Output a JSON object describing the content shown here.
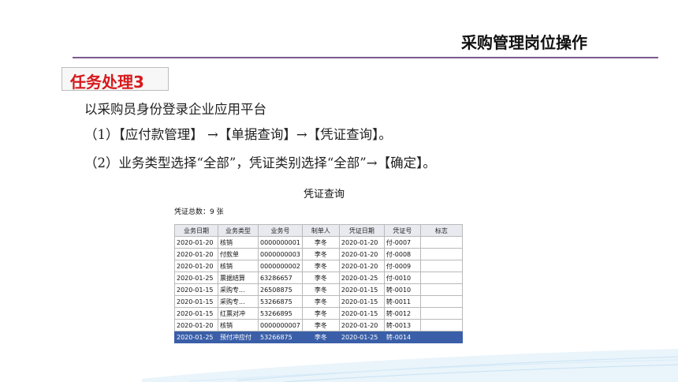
{
  "header": {
    "title": "采购管理岗位操作"
  },
  "task": {
    "label": "任务处理3"
  },
  "instructions": [
    "以采购员身份登录企业应用平台",
    "（1）【应付款管理】 →【单据查询】→【凭证查询】。",
    "（2）业务类型选择“全部”，凭证类别选择“全部”→【确定】。"
  ],
  "dialog": {
    "title": "凭证查询",
    "total": "凭证总数：9 张"
  },
  "table": {
    "headers": [
      "业务日期",
      "业务类型",
      "业务号",
      "制单人",
      "凭证日期",
      "凭证号",
      "标志"
    ],
    "rows": [
      [
        "2020-01-20",
        "核销",
        "0000000001",
        "李冬",
        "2020-01-20",
        "付-0007",
        ""
      ],
      [
        "2020-01-20",
        "付款单",
        "0000000003",
        "李冬",
        "2020-01-20",
        "付-0008",
        ""
      ],
      [
        "2020-01-20",
        "核销",
        "0000000002",
        "李冬",
        "2020-01-20",
        "付-0009",
        ""
      ],
      [
        "2020-01-25",
        "票据结算",
        "63286657",
        "李冬",
        "2020-01-25",
        "付-0010",
        ""
      ],
      [
        "2020-01-15",
        "采购专...",
        "26508875",
        "李冬",
        "2020-01-15",
        "转-0010",
        ""
      ],
      [
        "2020-01-15",
        "采购专...",
        "53266875",
        "李冬",
        "2020-01-15",
        "转-0011",
        ""
      ],
      [
        "2020-01-15",
        "红票对冲",
        "53266895",
        "李冬",
        "2020-01-15",
        "转-0012",
        ""
      ],
      [
        "2020-01-20",
        "核销",
        "0000000007",
        "李冬",
        "2020-01-20",
        "转-0013",
        ""
      ],
      [
        "2020-01-25",
        "预付冲应付",
        "53266875",
        "李冬",
        "2020-01-25",
        "转-0014",
        ""
      ]
    ],
    "selected_row": 8
  },
  "colors": {
    "rule": "#7b5a8e",
    "task_text": "#d7191c",
    "selected_row": "#3a5fa8"
  }
}
